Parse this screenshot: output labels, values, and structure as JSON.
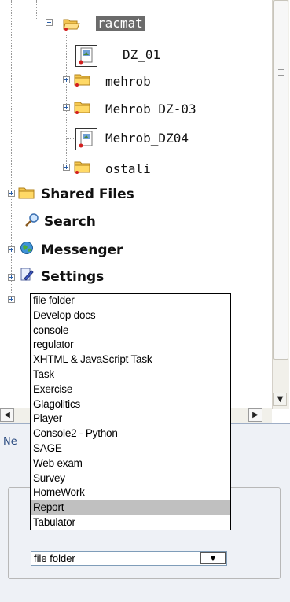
{
  "tree": {
    "nodes": [
      {
        "label": "racmat",
        "selected": true,
        "icon": "folder-open-icon"
      },
      {
        "label": "DZ_01",
        "icon": "document-icon"
      },
      {
        "label": "mehrob",
        "icon": "folder-icon"
      },
      {
        "label": "Mehrob_DZ-03",
        "icon": "folder-icon"
      },
      {
        "label": "Mehrob_DZ04",
        "icon": "document-icon"
      },
      {
        "label": "ostali",
        "icon": "folder-icon"
      }
    ],
    "sections": [
      {
        "label": "Shared Files",
        "icon": "folder-icon"
      },
      {
        "label": "Search",
        "icon": "magnifier-icon"
      },
      {
        "label": "Messenger",
        "icon": "globe-icon"
      },
      {
        "label": "Settings",
        "icon": "wrench-icon"
      }
    ]
  },
  "lower_panel": {
    "label_fragment": "Ne"
  },
  "select": {
    "value": "file folder"
  },
  "dropdown": {
    "highlighted": "Report",
    "options": [
      "file folder",
      "Develop docs",
      "console",
      "regulator",
      "XHTML & JavaScript Task",
      "Task",
      "Exercise",
      "Glagolitics",
      "Player",
      "Console2 - Python",
      "SAGE",
      "Web exam",
      "Survey",
      "HomeWork",
      "Report",
      "Tabulator"
    ]
  },
  "colors": {
    "selection": "#6b6b6b",
    "dropdown_highlight": "#c0c0c0",
    "panel_border": "#9eaec6"
  }
}
